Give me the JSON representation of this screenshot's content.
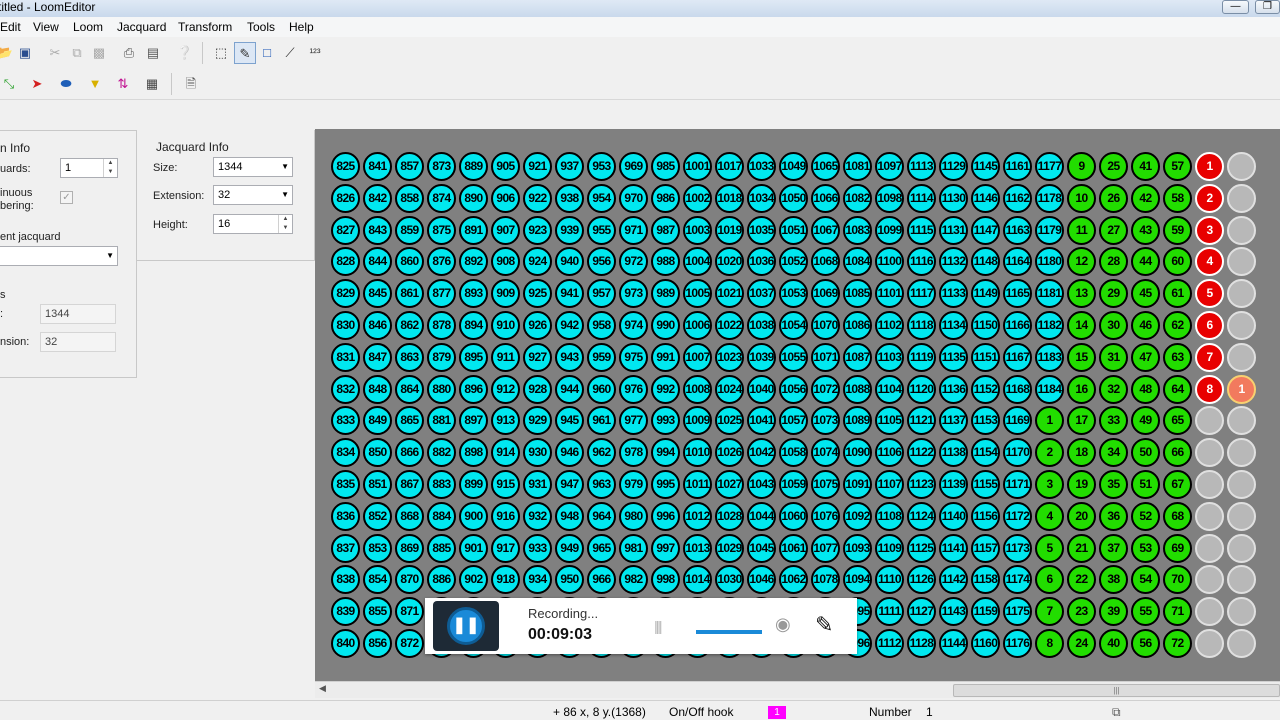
{
  "window": {
    "title": "titled - LoomEditor",
    "minimize_icon": "minimize-icon",
    "restore_icon": "restore-icon"
  },
  "menu": [
    "Edit",
    "View",
    "Loom",
    "Jacquard",
    "Transform",
    "Tools",
    "Help"
  ],
  "toolbar1": [
    "open-icon",
    "save-icon",
    "cut-icon",
    "copy-icon",
    "paste-icon",
    "print-icon",
    "print-preview-icon",
    "help-icon",
    "select-rect-icon",
    "draw-pen-icon",
    "fill-rect-icon",
    "line-icon",
    "number-icon"
  ],
  "toolbar2": [
    "green-arrows-icon",
    "red-shape-icon",
    "blue-eraser-icon",
    "yellow-funnel-icon",
    "swap-arrows-icon",
    "loom-icon",
    "export-icon"
  ],
  "left_panel": {
    "info_title": "n Info",
    "guards_label": "uards:",
    "guards_value": "1",
    "continuous_label": "inuous",
    "numbering_label": "bering:",
    "current_jacquard_label": "ent jacquard",
    "current_jacquard_value": "",
    "section_label": "s",
    "size_label": ":",
    "size_value": "1344",
    "extension_label": "nsion:",
    "extension_value": "32"
  },
  "jacquard_info": {
    "title": "Jacquard Info",
    "size_label": "Size:",
    "size_value": "1344",
    "extension_label": "Extension:",
    "extension_value": "32",
    "height_label": "Height:",
    "height_value": "16"
  },
  "grid": {
    "rows": 16,
    "base_first_col": 825,
    "cyan_columns": 23,
    "column_step": 16,
    "green_first_col_rows_0_7": 9,
    "green_first_col_rows_8_15": 1,
    "red_values_rows_0_7": [
      1,
      2,
      3,
      4,
      5,
      6,
      7,
      8
    ],
    "highlighted_cell_label": "1",
    "colors": {
      "cyan": "#00e8f0",
      "green": "#22dd00",
      "red": "#e80000",
      "empty": "#b8b8b8",
      "background": "#808080"
    }
  },
  "recording": {
    "status": "Recording...",
    "time": "00:09:03",
    "pause_icon": "pause-icon",
    "webcam_icon": "webcam-icon",
    "pen_icon": "pen-icon"
  },
  "status_bar": {
    "coords": "+ 86 x, 8 y.(1368)",
    "mode": "On/Off hook",
    "hook_value": "1",
    "number_label": "Number",
    "number_value": "1"
  }
}
